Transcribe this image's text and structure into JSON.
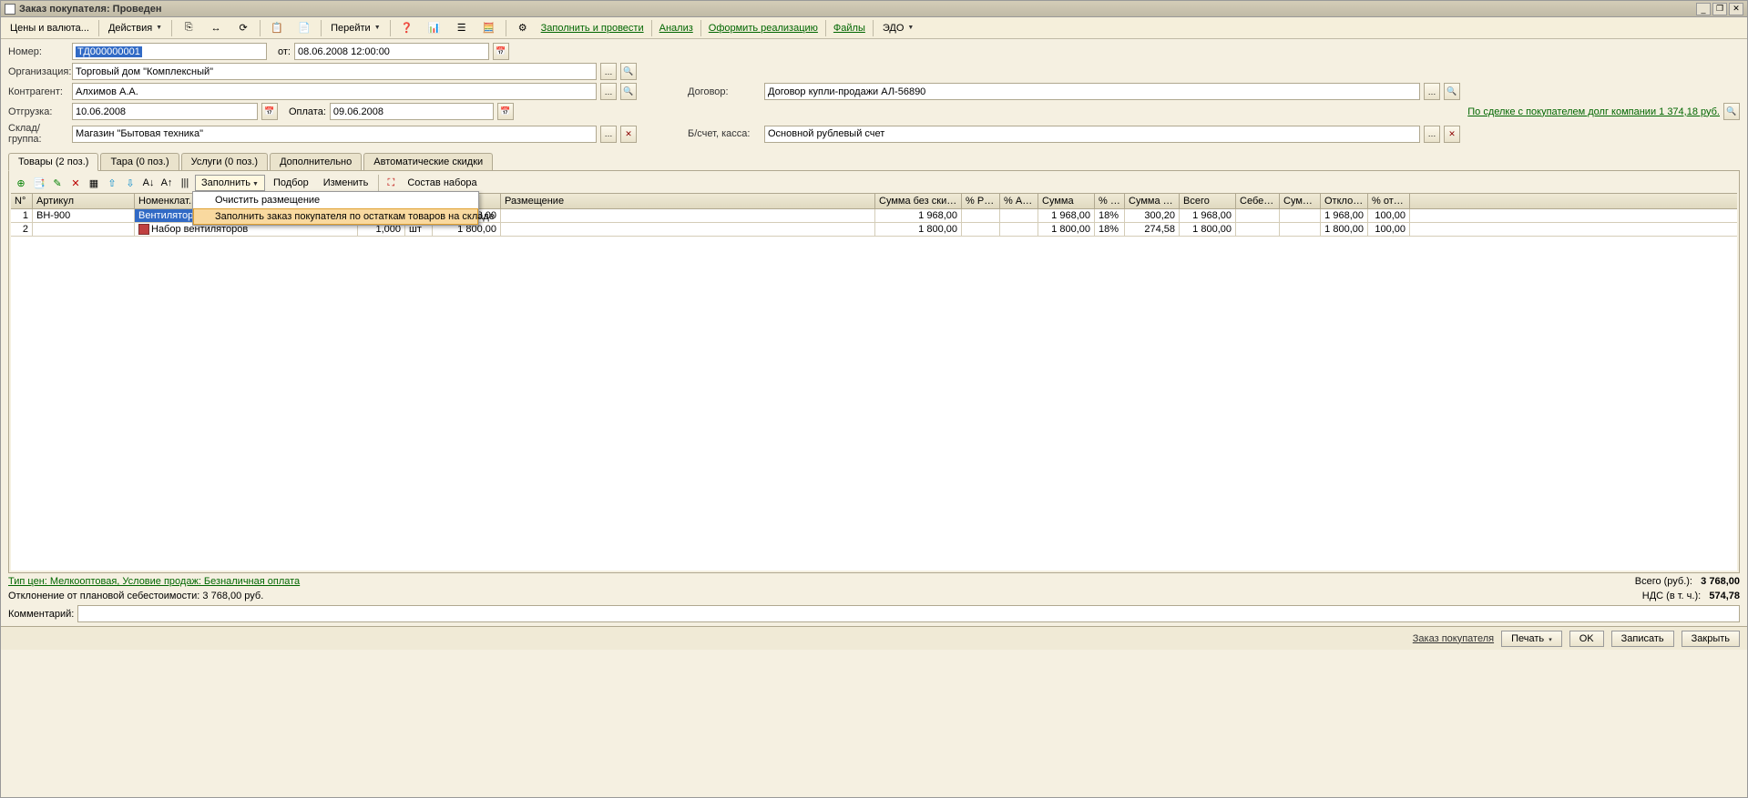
{
  "window": {
    "title": "Заказ покупателя: Проведен"
  },
  "toolbar": {
    "prices": "Цены и валюта...",
    "actions": "Действия",
    "go": "Перейти",
    "fill_post": "Заполнить и провести",
    "analysis": "Анализ",
    "make_sale": "Оформить реализацию",
    "files": "Файлы",
    "edo": "ЭДО"
  },
  "form": {
    "number_label": "Номер:",
    "number_value": "ТД000000001",
    "from_label": "от:",
    "date_value": "08.06.2008 12:00:00",
    "org_label": "Организация:",
    "org_value": "Торговый дом \"Комплексный\"",
    "contr_label": "Контрагент:",
    "contr_value": "Алхимов А.А.",
    "ship_label": "Отгрузка:",
    "ship_value": "10.06.2008",
    "pay_label": "Оплата:",
    "pay_value": "09.06.2008",
    "sklad_label": "Склад/группа:",
    "sklad_value": "Магазин \"Бытовая техника\"",
    "dogovor_label": "Договор:",
    "dogovor_value": "Договор купли-продажи АЛ-56890",
    "debt_text": "По сделке с покупателем долг компании 1 374,18 руб.",
    "acct_label": "Б/счет, касса:",
    "acct_value": "Основной рублевый счет"
  },
  "tabs": {
    "goods": "Товары (2 поз.)",
    "tara": "Тара (0 поз.)",
    "services": "Услуги (0 поз.)",
    "extra": "Дополнительно",
    "auto_disc": "Автоматические скидки"
  },
  "grid_toolbar": {
    "fill": "Заполнить",
    "pick": "Подбор",
    "change": "Изменить",
    "composition": "Состав набора"
  },
  "fill_menu": {
    "clear": "Очистить размещение",
    "by_stock": "Заполнить заказ покупателя по остаткам товаров на складе"
  },
  "grid": {
    "headers": {
      "n": "N°",
      "article": "Артикул",
      "nomenclature": "Номенклат...",
      "qty": "",
      "unit": "",
      "price": "",
      "placement": "Размещение",
      "sum_nodisc": "Сумма без скидок",
      "pct_manual": "% Руч...",
      "pct_auto": "% Авт...",
      "sum": "Сумма",
      "pct_vat": "% Н...",
      "sum_vat": "Сумма НДС",
      "total": "Всего",
      "cost": "Себесто...",
      "sum2": "Сумма ...",
      "dev": "Отклон...",
      "pct_dev": "% откло..."
    },
    "rows": [
      {
        "n": "1",
        "article": "ВН-900",
        "nomenclature": "Вентилятор",
        "qty": "",
        "unit": "",
        "price": "968,00",
        "placement": "",
        "sum_nodisc": "1 968,00",
        "pct_manual": "",
        "pct_auto": "",
        "sum": "1 968,00",
        "pct_vat": "18%",
        "sum_vat": "300,20",
        "total": "1 968,00",
        "cost": "",
        "sum2": "",
        "dev": "1 968,00",
        "pct_dev": "100,00"
      },
      {
        "n": "2",
        "article": "",
        "nomenclature": "Набор вентиляторов",
        "qty": "1,000",
        "unit": "шт",
        "price": "1 800,00",
        "placement": "",
        "sum_nodisc": "1 800,00",
        "pct_manual": "",
        "pct_auto": "",
        "sum": "1 800,00",
        "pct_vat": "18%",
        "sum_vat": "274,58",
        "total": "1 800,00",
        "cost": "",
        "sum2": "",
        "dev": "1 800,00",
        "pct_dev": "100,00"
      }
    ]
  },
  "footer": {
    "price_type": "Тип цен: Мелкооптовая, Условие продаж: Безналичная оплата",
    "deviation": "Отклонение от плановой себестоимости: 3 768,00 руб.",
    "total_label": "Всего (руб.):",
    "total_value": "3 768,00",
    "vat_label": "НДС (в т. ч.):",
    "vat_value": "574,78",
    "comment_label": "Комментарий:"
  },
  "bottom": {
    "order": "Заказ покупателя",
    "print": "Печать",
    "ok": "OK",
    "save": "Записать",
    "close": "Закрыть"
  }
}
